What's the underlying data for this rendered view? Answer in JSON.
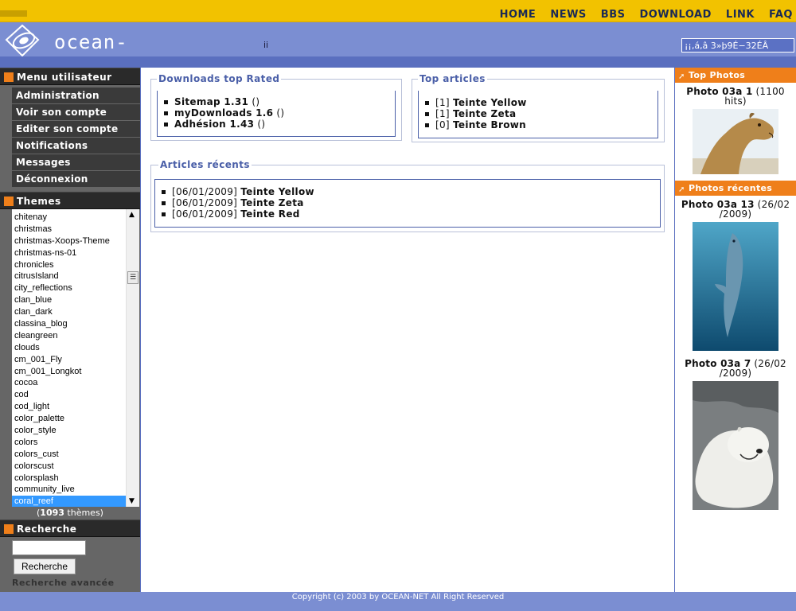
{
  "topnav": [
    "HOME",
    "NEWS",
    "BBS",
    "DOWNLOAD",
    "LINK",
    "FAQ"
  ],
  "header": {
    "logo_text": "ocean-net",
    "middle_text": "ii",
    "input_value": "¡¡‚á‚â 3»þ9É−32ÉÂ"
  },
  "user_menu": {
    "title": "Menu utilisateur",
    "items": [
      "Administration",
      "Voir son compte",
      "Editer son compte",
      "Notifications",
      "Messages",
      "Déconnexion"
    ]
  },
  "themes": {
    "title": "Themes",
    "items": [
      "chitenay",
      "christmas",
      "christmas-Xoops-Theme",
      "christmas-ns-01",
      "chronicles",
      "citrusIsland",
      "city_reflections",
      "clan_blue",
      "clan_dark",
      "classina_blog",
      "cleangreen",
      "clouds",
      "cm_001_Fly",
      "cm_001_Longkot",
      "cocoa",
      "cod",
      "cod_light",
      "color_palette",
      "color_style",
      "colors",
      "colors_cust",
      "colorscust",
      "colorsplash",
      "community_live",
      "coral_reef"
    ],
    "selected": "coral_reef",
    "count_open": "(",
    "count_num": "1093",
    "count_rest": " thèmes)"
  },
  "search": {
    "title": "Recherche",
    "input_value": "",
    "button_label": "Recherche",
    "advanced_label": "Recherche avancée"
  },
  "downloads": {
    "title": "Downloads top Rated",
    "items": [
      {
        "name": "Sitemap 1.31",
        "extra": " ()"
      },
      {
        "name": "myDownloads 1.6",
        "extra": " ()"
      },
      {
        "name": "Adhésion 1.43",
        "extra": " ()"
      }
    ]
  },
  "top_articles": {
    "title": "Top articles",
    "items": [
      {
        "count": "[1] ",
        "name": "Teinte Yellow"
      },
      {
        "count": "[1] ",
        "name": "Teinte Zeta"
      },
      {
        "count": "[0] ",
        "name": "Teinte Brown"
      }
    ]
  },
  "recent_articles": {
    "title": "Articles récents",
    "items": [
      {
        "date": "[06/01/2009] ",
        "name": "Teinte Yellow"
      },
      {
        "date": "[06/01/2009] ",
        "name": "Teinte Zeta"
      },
      {
        "date": "[06/01/2009] ",
        "name": "Teinte Red"
      }
    ]
  },
  "top_photos": {
    "title": "Top Photos",
    "items": [
      {
        "name": "Photo 03a 1",
        "detail": " (1100 hits)"
      }
    ]
  },
  "recent_photos": {
    "title": "Photos récentes",
    "items": [
      {
        "name": "Photo 03a 13",
        "detail": " (26/02 /2009)"
      },
      {
        "name": "Photo 03a 7",
        "detail": " (26/02 /2009)"
      }
    ]
  },
  "footer": {
    "text": "Copyright (c) 2003 by OCEAN-NET All Right Reserved"
  }
}
